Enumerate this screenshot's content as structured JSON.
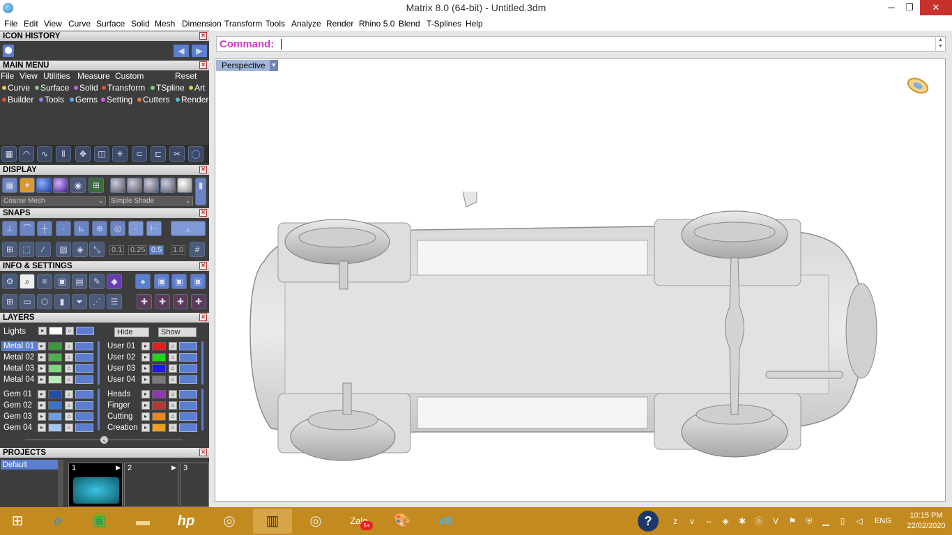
{
  "window": {
    "title": "Matrix 8.0 (64-bit) - Untitled.3dm",
    "minimize": "─",
    "maximize": "❐",
    "close": "✕"
  },
  "menubar": [
    "File",
    "Edit",
    "View",
    "Curve",
    "Surface",
    "Solid",
    "Mesh",
    "Dimension",
    "Transform",
    "Tools",
    "Analyze",
    "Render",
    "Rhino 5.0",
    "Blend",
    "T-Splines",
    "Help"
  ],
  "panels": {
    "icon_history": "ICON HISTORY",
    "main_menu": "MAIN MENU",
    "main_menu_row1": [
      "File",
      "View",
      "Utilities",
      "Measure",
      "Custom",
      "Reset"
    ],
    "main_menu_row2": [
      {
        "label": "Curve",
        "color": "#e6c84a"
      },
      {
        "label": "Surface",
        "color": "#7fc97f"
      },
      {
        "label": "Solid",
        "color": "#b26be0"
      },
      {
        "label": "Transform",
        "color": "#e0503a"
      },
      {
        "label": "TSpline",
        "color": "#7fd07f"
      },
      {
        "label": "Art",
        "color": "#e6c84a"
      }
    ],
    "main_menu_row3": [
      {
        "label": "Builder",
        "color": "#e0503a"
      },
      {
        "label": "Tools",
        "color": "#9b7fe0"
      },
      {
        "label": "Gems",
        "color": "#5aa9e6"
      },
      {
        "label": "Setting",
        "color": "#d060d0"
      },
      {
        "label": "Cutters",
        "color": "#e07f3a"
      },
      {
        "label": "Render",
        "color": "#5ac0c0"
      }
    ],
    "display": "DISPLAY",
    "display_mesh": "Coarse Mesh",
    "display_shade": "Simple Shade",
    "snaps": "SNAPS",
    "snap_values": [
      "0.1",
      "0.25",
      "0.5",
      "1.0"
    ],
    "info_settings": "INFO & SETTINGS",
    "layers": "LAYERS",
    "lights_label": "Lights",
    "hide_label": "Hide",
    "show_label": "Show",
    "projects": "PROJECTS",
    "projects_default": "Default",
    "project_slots": [
      "1",
      "2",
      "3"
    ]
  },
  "layers_left": [
    {
      "name": "Metal 01",
      "color": "#3a9a3a",
      "selected": true
    },
    {
      "name": "Metal 02",
      "color": "#4fb04f",
      "selected": false
    },
    {
      "name": "Metal 03",
      "color": "#7fd67f",
      "selected": false
    },
    {
      "name": "Metal 04",
      "color": "#b8ecb8",
      "selected": false
    },
    {
      "name": "Gem 01",
      "color": "#1e4fa8",
      "selected": false
    },
    {
      "name": "Gem 02",
      "color": "#3b74cf",
      "selected": false
    },
    {
      "name": "Gem 03",
      "color": "#6b9ee6",
      "selected": false
    },
    {
      "name": "Gem 04",
      "color": "#a6c6f2",
      "selected": false
    }
  ],
  "layers_right": [
    {
      "name": "User 01",
      "color": "#e61e1e"
    },
    {
      "name": "User 02",
      "color": "#22d422"
    },
    {
      "name": "User 03",
      "color": "#1a1ae6"
    },
    {
      "name": "User 04",
      "color": "#7a7a7a"
    },
    {
      "name": "Heads",
      "color": "#8a3ab0"
    },
    {
      "name": "Finger",
      "color": "#b03a3a"
    },
    {
      "name": "Cutting",
      "color": "#e6881a"
    },
    {
      "name": "Creation",
      "color": "#f0a020"
    }
  ],
  "command": {
    "label": "Command:",
    "value": ""
  },
  "viewport": {
    "name": "Perspective"
  },
  "taskbar": {
    "time": "10:15 PM",
    "date": "22/02/2020",
    "lang": "ENG",
    "zalo_badge": "5+"
  }
}
